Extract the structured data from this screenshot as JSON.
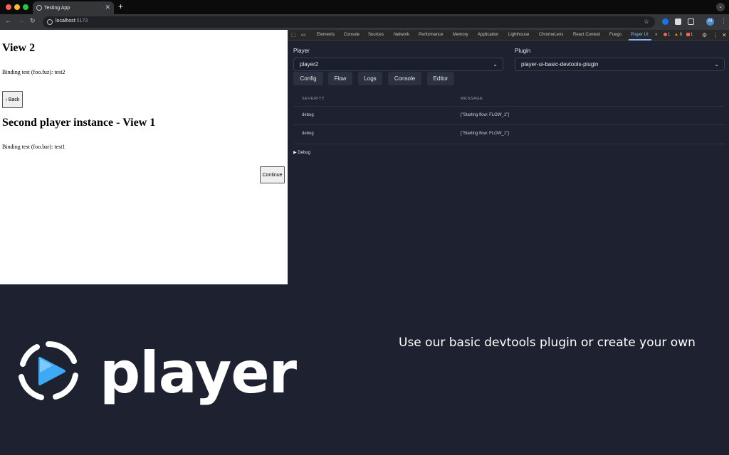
{
  "browser": {
    "tab_title": "Testing App",
    "new_tab": "+",
    "url_host": "localhost",
    "url_port": ":5173"
  },
  "page": {
    "view2_heading": "View 2",
    "view2_binding": "Binding test (foo.fuz): test2",
    "back_label": "‹ Back",
    "instance_heading": "Second player instance - View 1",
    "instance_binding": "Binding test (foo.bar): test1",
    "continue_label": "Continue"
  },
  "devtools": {
    "tabs": [
      "Elements",
      "Console",
      "Sources",
      "Network",
      "Performance",
      "Memory",
      "Application",
      "Lighthouse",
      "ChromeLens",
      "React Context",
      "Fuego",
      "Player UI"
    ],
    "more": "»",
    "errors": "1",
    "warnings": "8",
    "issues": "1",
    "player_label": "Player",
    "player_value": "player2",
    "plugin_label": "Plugin",
    "plugin_value": "player-ui-basic-devtools-plugin",
    "buttons": [
      "Config",
      "Flow",
      "Logs",
      "Console",
      "Editor"
    ],
    "table": {
      "headers": [
        "SEVERITY",
        "MESSAGE"
      ],
      "rows": [
        {
          "severity": "debug",
          "message": "[\"Starting flow: FLOW_1\"]"
        },
        {
          "severity": "debug",
          "message": "[\"Starting flow: FLOW_1\"]"
        }
      ]
    },
    "debug_toggle": "▶ Debug"
  },
  "branding": {
    "wordmark": "player",
    "tagline": "Use our basic devtools plugin or create your own"
  },
  "colors": {
    "background": "#1e2230",
    "accent_blue": "#3fa9f5",
    "active_tab": "#8ab4f8"
  }
}
